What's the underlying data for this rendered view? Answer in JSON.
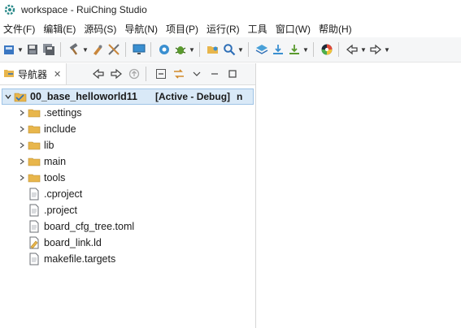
{
  "window": {
    "title": "workspace - RuiChing Studio"
  },
  "menu": [
    "文件(F)",
    "编辑(E)",
    "源码(S)",
    "导航(N)",
    "项目(P)",
    "运行(R)",
    "工具",
    "窗口(W)",
    "帮助(H)"
  ],
  "navigator": {
    "tab_label": "导航器",
    "tab_close": "✕",
    "root": {
      "name": "00_base_helloworld11",
      "status": "[Active - Debug]",
      "trailing": "n"
    },
    "items": [
      {
        "label": ".settings",
        "type": "folder"
      },
      {
        "label": "include",
        "type": "folder"
      },
      {
        "label": "lib",
        "type": "folder"
      },
      {
        "label": "main",
        "type": "folder"
      },
      {
        "label": "tools",
        "type": "folder"
      },
      {
        "label": ".cproject",
        "type": "file"
      },
      {
        "label": ".project",
        "type": "file"
      },
      {
        "label": "board_cfg_tree.toml",
        "type": "file"
      },
      {
        "label": "board_link.ld",
        "type": "linker-file"
      },
      {
        "label": "makefile.targets",
        "type": "file"
      }
    ]
  },
  "icons": {
    "expanded": "expand-arrow-icon",
    "collapsed": "collapse-arrow-icon"
  },
  "colors": {
    "accent": "#3d84c6",
    "selection": "#d9e9f7",
    "folder": "#e8b64c"
  }
}
